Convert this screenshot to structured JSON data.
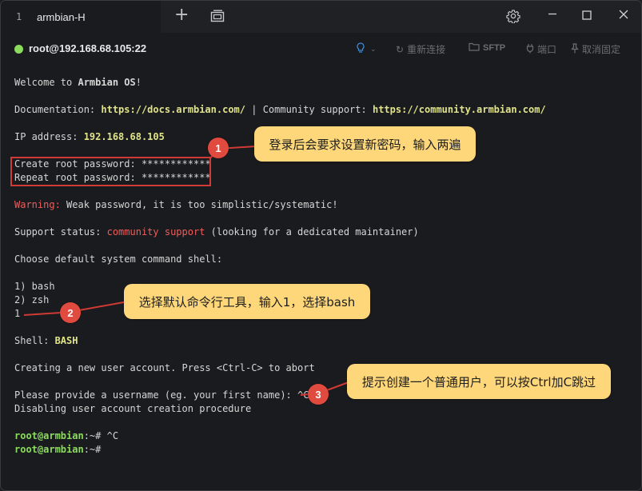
{
  "window": {
    "tab_number": "1",
    "tab_title": "armbian-H",
    "icons": {
      "new_tab": "plus-icon",
      "tabs": "window-tabs-icon",
      "settings": "gear-icon",
      "minimize": "minimize-icon",
      "maximize": "maximize-icon",
      "close": "close-icon"
    }
  },
  "toolbar": {
    "status_color": "#8bdc5c",
    "host": "root@192.168.68.105:22",
    "reconnect": "重新连接",
    "sftp": "SFTP",
    "port": "端口",
    "unpin": "取消固定"
  },
  "terminal": {
    "welcome_prefix": "Welcome to ",
    "os_name": "Armbian OS",
    "welcome_suffix": "!",
    "doc_label": "Documentation: ",
    "doc_url": "https://docs.armbian.com/",
    "sep": " | ",
    "community_label": "Community support: ",
    "community_url": "https://community.armbian.com/",
    "ip_label": "IP address: ",
    "ip_value": "192.168.68.105",
    "create_pw": "Create root password: ************",
    "repeat_pw": "Repeat root password: ************",
    "warning_label": "Warning:",
    "warning_text": " Weak password, it is too simplistic/systematic!",
    "support_label": "Support status: ",
    "support_value": "community support",
    "support_suffix": " (looking for a dedicated maintainer)",
    "choose_shell": "Choose default system command shell:",
    "opt1": "1) bash",
    "opt2": "2) zsh",
    "input1": "1",
    "shell_label": "Shell: ",
    "shell_value": "BASH",
    "creating": "Creating a new user account. Press <Ctrl-C> to abort",
    "provide": "Please provide a username (eg. your first name): ^C",
    "disabling": "Disabling user account creation procedure",
    "prompt_user": "root@armbian",
    "prompt_path": ":~# ",
    "cmd1": "^C",
    "prompt2_path": ":~#"
  },
  "annotations": [
    {
      "number": "1",
      "text": "登录后会要求设置新密码，输入两遍"
    },
    {
      "number": "2",
      "text": "选择默认命令行工具，输入1，选择bash"
    },
    {
      "number": "3",
      "text": "提示创建一个普通用户，可以按Ctrl加C跳过"
    }
  ],
  "colors": {
    "highlight_yellow": "#e0e38a",
    "warning_red": "#ef5d5d",
    "prompt_green": "#8bdc5c",
    "callout_bg": "#fdd77a",
    "badge_red": "#e04a3f"
  }
}
